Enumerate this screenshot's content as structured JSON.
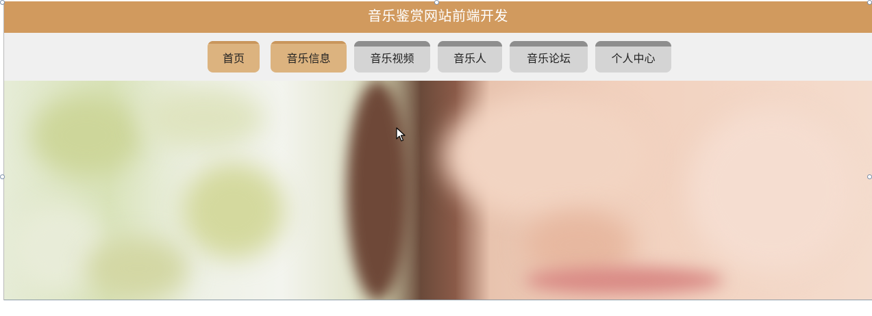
{
  "header": {
    "title": "音乐鉴赏网站前端开发"
  },
  "nav": {
    "tabs": [
      {
        "label": "首页",
        "active": true
      },
      {
        "label": "音乐信息",
        "active": true
      },
      {
        "label": "音乐视频",
        "active": false
      },
      {
        "label": "音乐人",
        "active": false
      },
      {
        "label": "音乐论坛",
        "active": false
      },
      {
        "label": "个人中心",
        "active": false
      }
    ]
  },
  "banner": {
    "image": "hero-banner-woman-smiling"
  },
  "colors": {
    "header_bg": "#d19a5e",
    "nav_bg": "#f0f0f0",
    "tab_active": "#dcb37f",
    "tab_inactive": "#d4d4d4"
  }
}
